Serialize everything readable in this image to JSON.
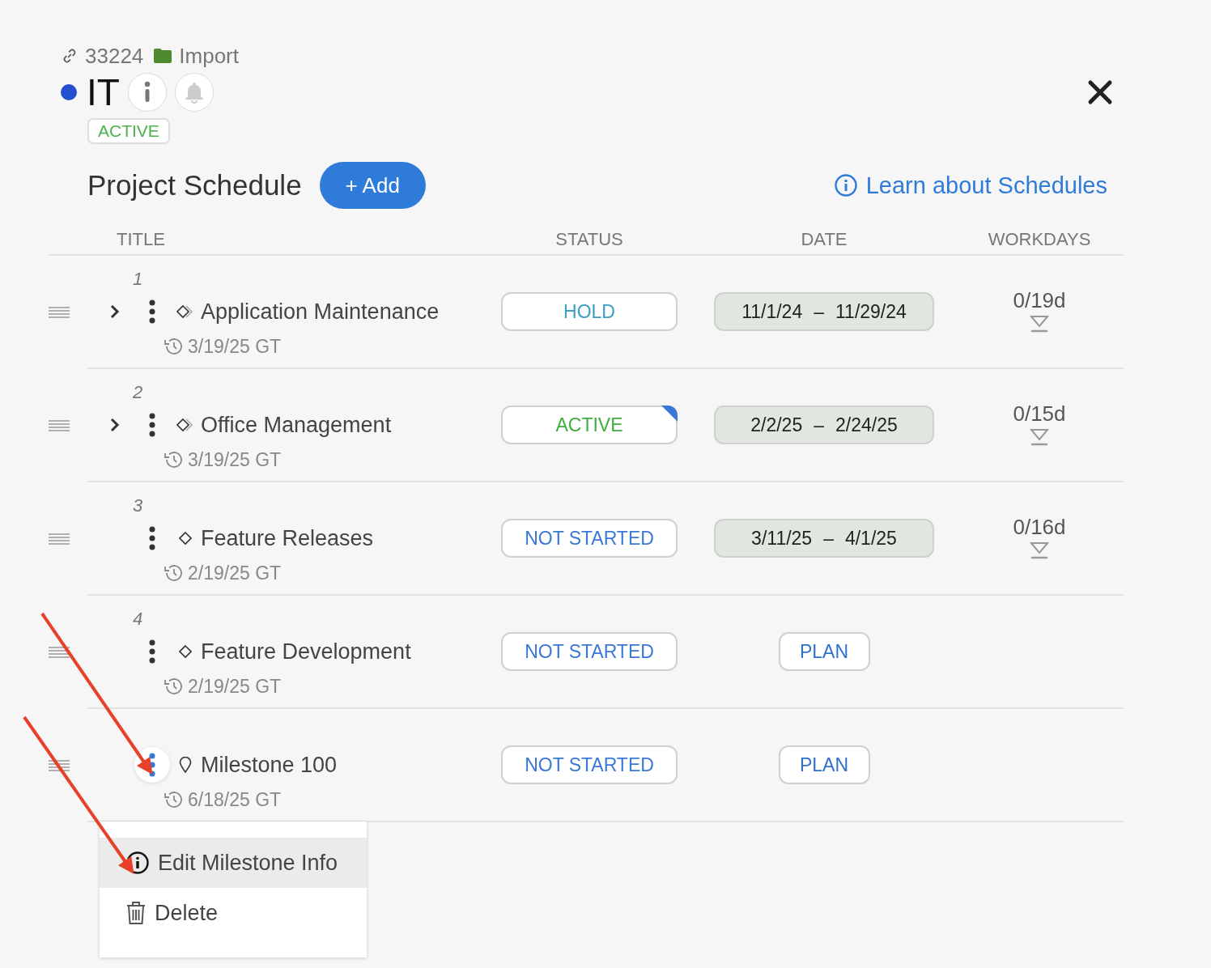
{
  "breadcrumb": {
    "id": "33224",
    "folder": "Import"
  },
  "project": {
    "name": "IT",
    "color": "#2450d0",
    "status": "ACTIVE"
  },
  "schedule": {
    "title": "Project Schedule",
    "add_button": "+ Add",
    "learn_link": "Learn about Schedules"
  },
  "table": {
    "columns": [
      "TITLE",
      "STATUS",
      "DATE",
      "WORKDAYS"
    ],
    "rows": [
      {
        "kind": "phase",
        "number": "1",
        "title": "Application Maintenance",
        "expandable": true,
        "menu_open": false,
        "updated": "3/19/25 GT",
        "status": "HOLD",
        "color": "#3a9fc4",
        "flagged": false,
        "date": {
          "kind": "range",
          "start": "11/1/24",
          "separator": "–",
          "end": "11/29/24"
        },
        "workdays": "0/19d"
      },
      {
        "kind": "phase",
        "number": "2",
        "title": "Office Management",
        "expandable": true,
        "menu_open": false,
        "updated": "3/19/25 GT",
        "status": "ACTIVE",
        "color": "#3fae3f",
        "flagged": true,
        "date": {
          "kind": "range",
          "start": "2/2/25",
          "separator": "–",
          "end": "2/24/25"
        },
        "workdays": "0/15d"
      },
      {
        "kind": "task",
        "number": "3",
        "title": "Feature Releases",
        "expandable": false,
        "menu_open": false,
        "updated": "2/19/25 GT",
        "status": "NOT STARTED",
        "color": "#3a78d8",
        "flagged": false,
        "date": {
          "kind": "range",
          "start": "3/11/25",
          "separator": "–",
          "end": "4/1/25"
        },
        "workdays": "0/16d"
      },
      {
        "kind": "task",
        "number": "4",
        "title": "Feature Development",
        "expandable": false,
        "menu_open": false,
        "updated": "2/19/25 GT",
        "status": "NOT STARTED",
        "color": "#3a78d8",
        "flagged": false,
        "date": {
          "kind": "plan",
          "label": "PLAN"
        }
      },
      {
        "kind": "milestone",
        "title": "Milestone 100",
        "expandable": false,
        "menu_open": true,
        "updated": "6/18/25 GT",
        "status": "NOT STARTED",
        "color": "#3a78d8",
        "flagged": false,
        "date": {
          "kind": "plan",
          "label": "PLAN"
        }
      }
    ]
  },
  "context_menu": {
    "items": [
      {
        "kind": "info",
        "label": "Edit Milestone Info",
        "selected": true
      },
      {
        "kind": "delete",
        "label": "Delete",
        "selected": false
      }
    ]
  }
}
